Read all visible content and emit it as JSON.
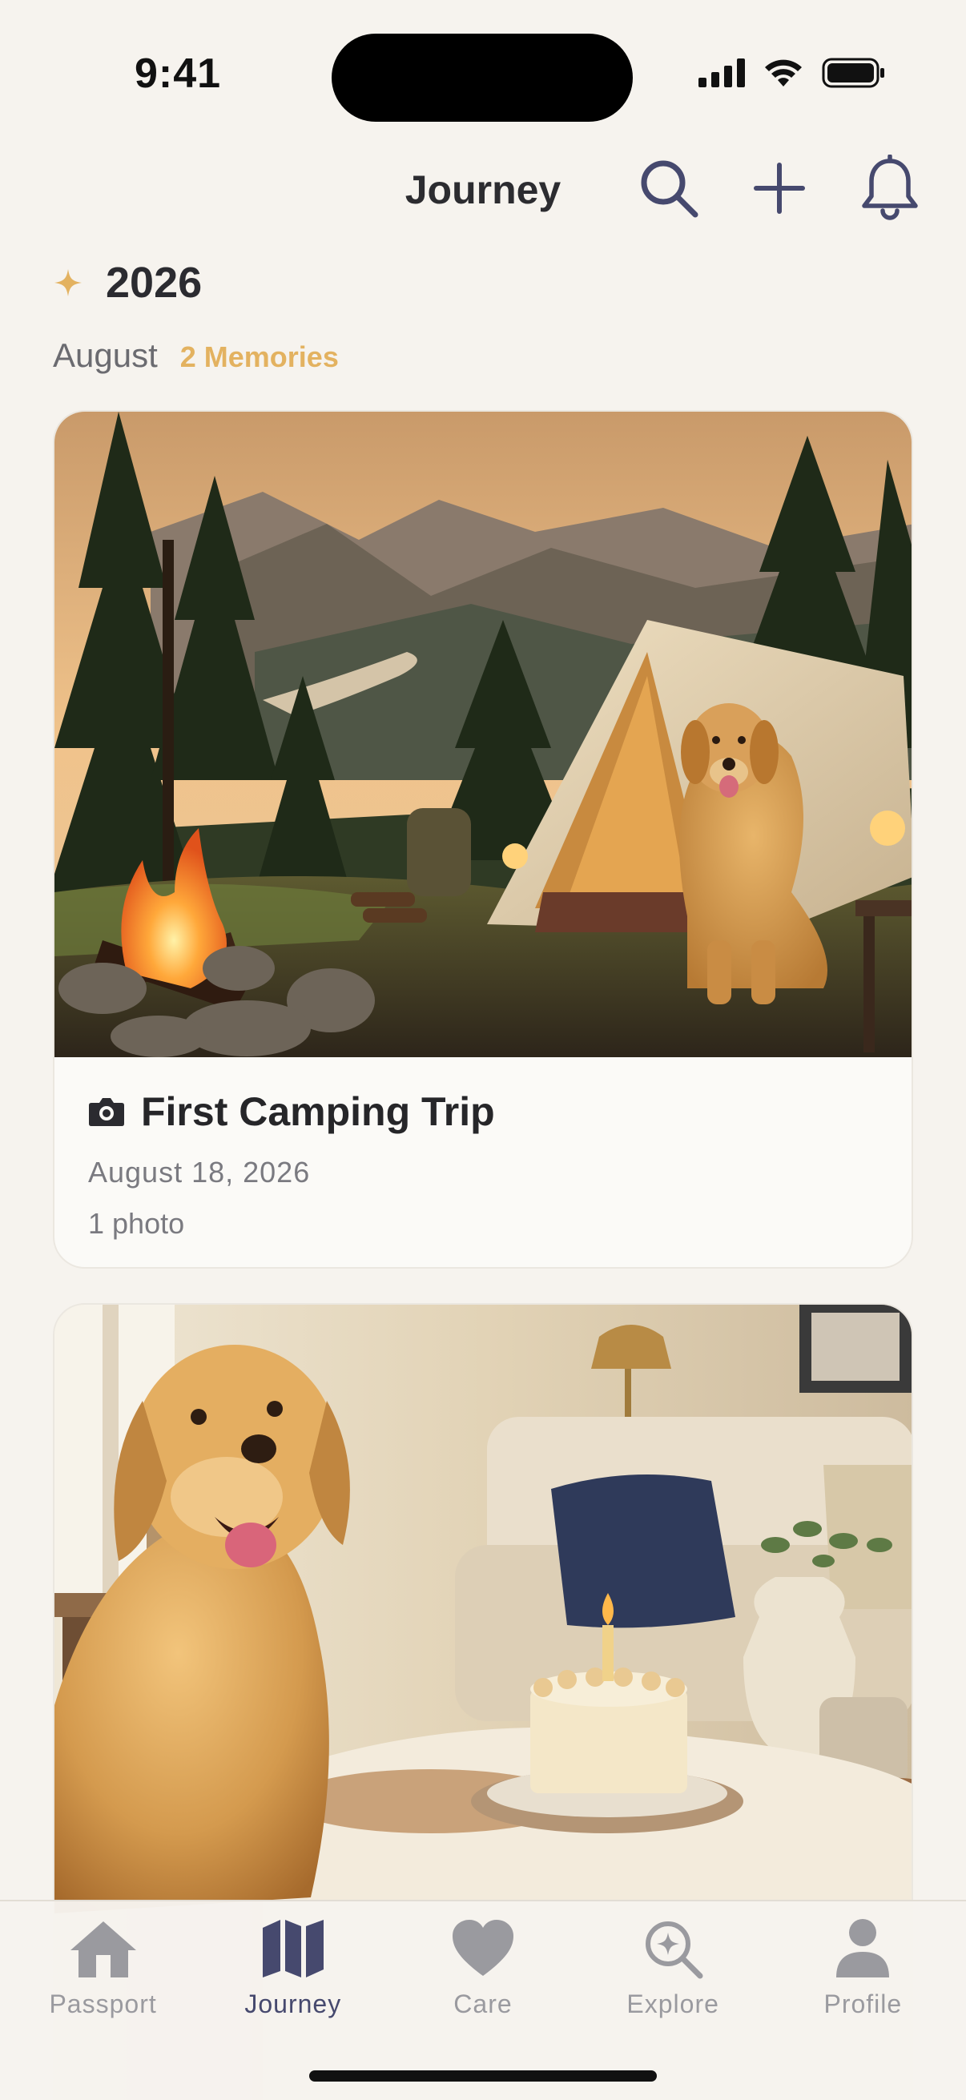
{
  "status_bar": {
    "time": "9:41"
  },
  "header": {
    "title": "Journey"
  },
  "timeline": {
    "year": "2026",
    "month": "August",
    "memories_count": "2 Memories"
  },
  "memories": [
    {
      "title": "First Camping Trip",
      "date": "August 18, 2026",
      "count": "1 photo",
      "type_icon": "camera-icon"
    },
    {
      "title": "",
      "date": "",
      "count": ""
    }
  ],
  "tabs": [
    {
      "label": "Passport",
      "icon": "home-icon",
      "active": false
    },
    {
      "label": "Journey",
      "icon": "map-icon",
      "active": true
    },
    {
      "label": "Care",
      "icon": "heart-icon",
      "active": false
    },
    {
      "label": "Explore",
      "icon": "explore-icon",
      "active": false
    },
    {
      "label": "Profile",
      "icon": "profile-icon",
      "active": false
    }
  ],
  "colors": {
    "background": "#f6f3ee",
    "accent_navy": "#46496e",
    "accent_gold": "#e3b260",
    "inactive": "#9a9a9f"
  }
}
